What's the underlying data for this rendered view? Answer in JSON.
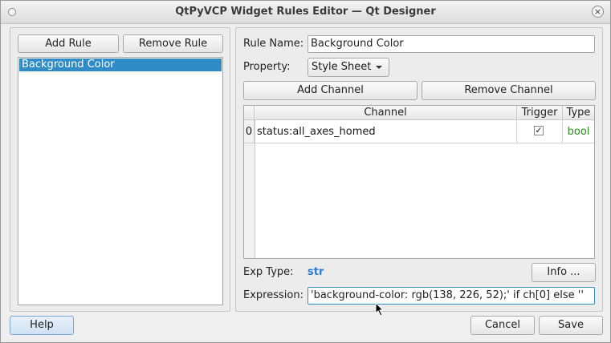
{
  "window": {
    "title": "QtPyVCP Widget Rules Editor — Qt Designer",
    "close_glyph": "×"
  },
  "rules_panel": {
    "add_rule_label": "Add Rule",
    "remove_rule_label": "Remove Rule",
    "rules": [
      "Background Color"
    ],
    "selected_rule": "Background Color"
  },
  "editor": {
    "rule_name_label": "Rule Name:",
    "rule_name_value": "Background Color",
    "property_label": "Property:",
    "property_value": "Style Sheet",
    "add_channel_label": "Add Channel",
    "remove_channel_label": "Remove Channel",
    "table": {
      "headers": {
        "channel": "Channel",
        "trigger": "Trigger",
        "type": "Type"
      },
      "rows": [
        {
          "index": "0",
          "channel": "status:all_axes_homed",
          "trigger": "✓",
          "type": "bool"
        }
      ]
    },
    "exp_type_label": "Exp Type:",
    "exp_type_value": "str",
    "info_label": "Info ...",
    "expression_label": "Expression:",
    "expression_value": "'background-color: rgb(138, 226, 52);' if ch[0] else ''"
  },
  "footer": {
    "help_label": "Help",
    "cancel_label": "Cancel",
    "save_label": "Save"
  },
  "colors": {
    "accent": "#308cc6",
    "type_green": "#2e8b1e",
    "exp_type_blue": "#2a7fd4"
  }
}
